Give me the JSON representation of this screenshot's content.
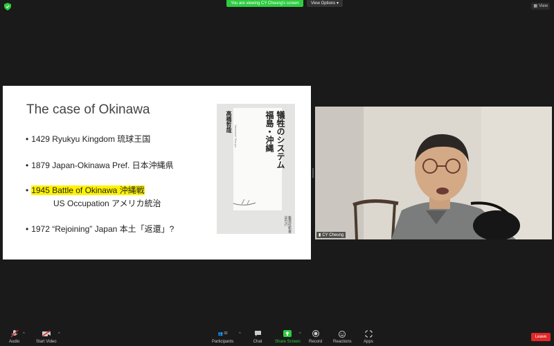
{
  "top_bar": {
    "share_banner": "You are viewing CY Cheung's screen",
    "view_options": "View Options",
    "view_button": "View"
  },
  "slide": {
    "title": "The case of Okinawa",
    "bullets": [
      "1429 Ryukyu Kingdom 琉球王国",
      "1879 Japan-Okinawa Pref. 日本沖縄県",
      "1945 Battle of Okinawa 沖縄戦",
      "1972 “Rejoining” Japan 本土「返還」?"
    ],
    "sub_bullet": "US Occupation アメリカ統治",
    "bullet_dot": "•",
    "book": {
      "title_lines": [
        "犠牲のシステム",
        "福島・沖縄"
      ],
      "author": "高橋哲哉",
      "romaji": "Takahashi Tetsuya",
      "publisher": "集英社新書 0627C"
    }
  },
  "video": {
    "participant_name": "CY Cheung"
  },
  "toolbar": {
    "audio": "Audio",
    "start_video": "Start Video",
    "participants": "Participants",
    "participant_count": "32",
    "chat": "Chat",
    "share_screen": "Share Screen",
    "record": "Record",
    "reactions": "Reactions",
    "apps": "Apps",
    "leave": "Leave"
  },
  "colors": {
    "share_banner": "#2ecc40",
    "highlight": "#fff200",
    "leave": "#e02828"
  }
}
